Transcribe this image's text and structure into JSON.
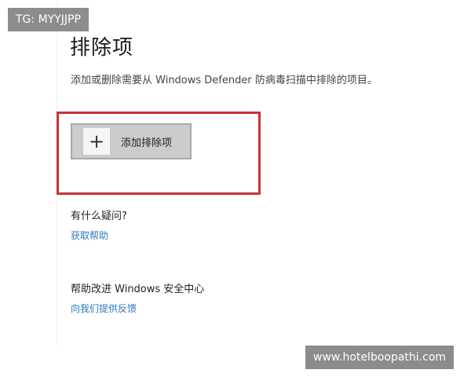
{
  "header": {
    "title": "排除项",
    "description": "添加或删除需要从 Windows Defender 防病毒扫描中排除的项目。"
  },
  "actions": {
    "add_exclusion_icon": "+",
    "add_exclusion_label": "添加排除项"
  },
  "help": {
    "heading": "有什么疑问?",
    "link": "获取帮助"
  },
  "improve": {
    "heading": "帮助改进 Windows 安全中心",
    "link": "向我们提供反馈"
  },
  "watermarks": {
    "top_left": "TG: MYYJJPP",
    "bottom_right": "www.hotelboopathi.com"
  },
  "colors": {
    "highlight": "#c8323a",
    "link": "#2c7bbf",
    "button_bg": "#cccccc"
  }
}
